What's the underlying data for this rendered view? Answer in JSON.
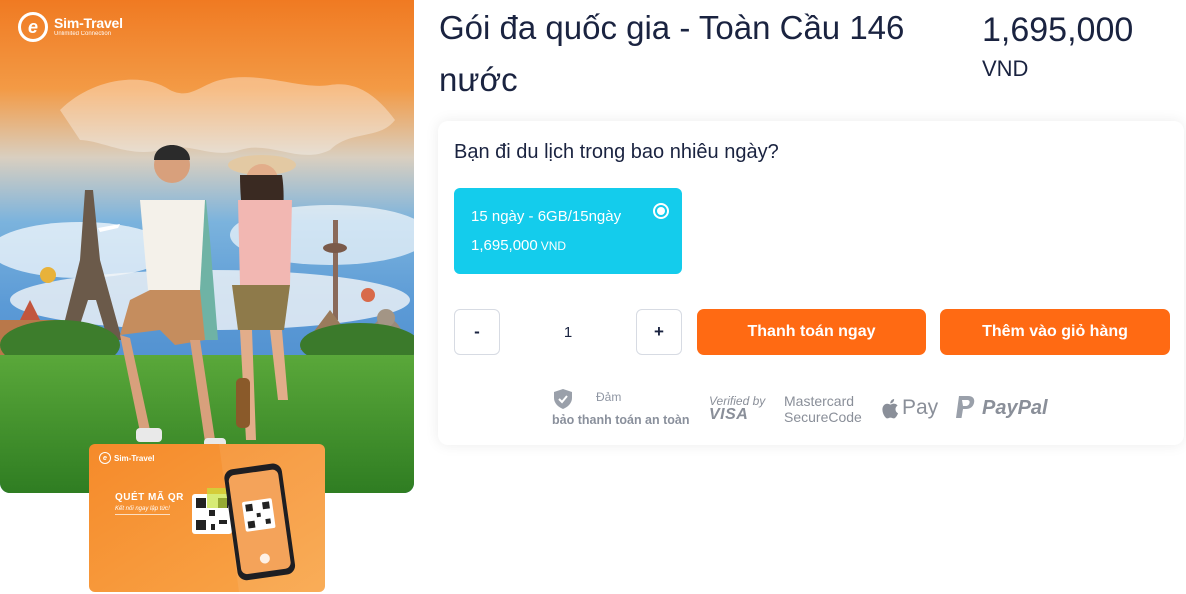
{
  "brand": {
    "name": "Sim-Travel",
    "tagline": "Unlimited Connection"
  },
  "qr_card": {
    "brand": "Sim-Travel",
    "title": "QUÉT MÃ QR",
    "subtitle": "Kết nối ngay lập tức!"
  },
  "product": {
    "title": "Gói đa quốc gia - Toàn Cầu 146 nước",
    "price": "1,695,000",
    "currency": "VND"
  },
  "options": {
    "question": "Bạn đi du lịch trong bao nhiêu ngày?",
    "plans": [
      {
        "name": "15 ngày - 6GB/15ngày",
        "price": "1,695,000",
        "currency": "VND",
        "selected": true
      }
    ]
  },
  "quantity": {
    "minus_label": "-",
    "value": "1",
    "plus_label": "+"
  },
  "actions": {
    "pay_now": "Thanh toán ngay",
    "add_to_cart": "Thêm vào giỏ hàng"
  },
  "secure": {
    "line1": "Đảm",
    "line2": "bảo thanh toán an toàn"
  },
  "payment_logos": {
    "visa_line1": "Verified by",
    "visa_line2": "VISA",
    "mastercard_line1": "Mastercard",
    "mastercard_line2": "SecureCode",
    "applepay": "Pay",
    "paypal": "PayPal"
  },
  "colors": {
    "accent_orange": "#ff6a13",
    "plan_cyan": "#14ccec",
    "title_navy": "#1a2340"
  }
}
